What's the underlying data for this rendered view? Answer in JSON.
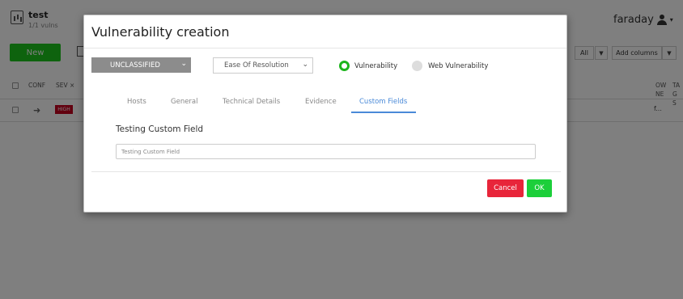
{
  "workspace": {
    "name": "test",
    "vulns_count": "1/1 vulns"
  },
  "header": {
    "username": "faraday"
  },
  "toolbar": {
    "new_label": "New",
    "all_label": "All",
    "add_columns_label": "Add columns"
  },
  "table": {
    "columns": [
      "CONF",
      "SEV",
      "OWNE",
      "TAGS"
    ],
    "rows": [
      {
        "severity": "HIGH",
        "owner": "f..."
      }
    ]
  },
  "modal": {
    "title": "Vulnerability creation",
    "classification": "UNCLASSIFIED",
    "ease_of_resolution": "Ease Of Resolution",
    "radio": {
      "vulnerability": "Vulnerability",
      "web_vulnerability": "Web Vulnerability",
      "selected": "vulnerability"
    },
    "tabs": [
      "Hosts",
      "General",
      "Technical Details",
      "Evidence",
      "Custom Fields"
    ],
    "active_tab": "Custom Fields",
    "custom_field": {
      "label": "Testing Custom Field",
      "placeholder": "Testing Custom Field",
      "value": ""
    },
    "buttons": {
      "cancel": "Cancel",
      "ok": "OK"
    }
  },
  "colors": {
    "accent_green": "#1cc71c",
    "cancel_red": "#e8253a",
    "ok_green": "#1ccf3a",
    "active_tab_blue": "#4a8ad8",
    "severity_high": "#c4001f",
    "classification_bg": "#8c8c8c"
  },
  "icons": {
    "workspace": "workspace-chart-icon",
    "user": "user-icon",
    "row_action": "arrow-right-icon",
    "dropdown": "chevron-down-icon"
  }
}
